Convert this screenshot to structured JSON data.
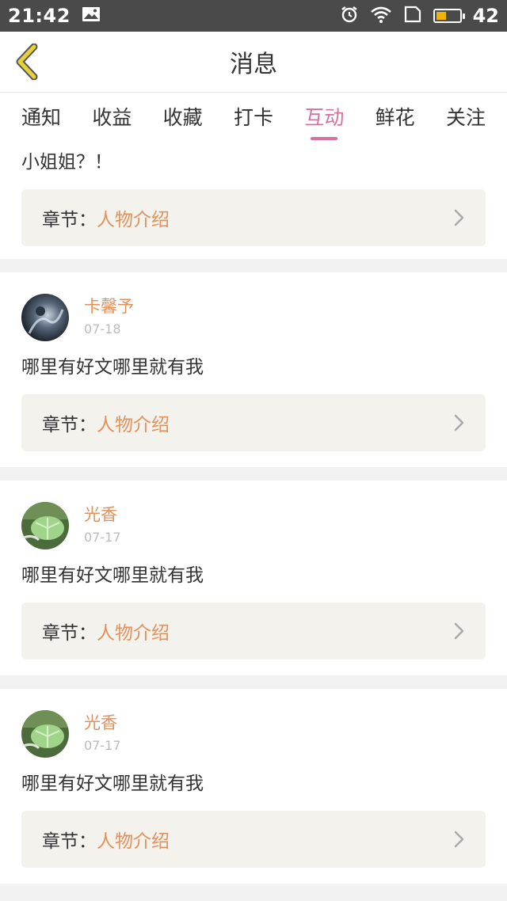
{
  "status_bar": {
    "time": "21:42",
    "battery": "42",
    "battery_level": 0.42,
    "icons": [
      "image-icon",
      "alarm-icon",
      "wifi-icon",
      "sim-icon",
      "battery-icon"
    ]
  },
  "header": {
    "title": "消息",
    "back_icon": "chevron-left-icon",
    "back_color": "#e5d23a"
  },
  "tabs": [
    {
      "label": "通知"
    },
    {
      "label": "收益"
    },
    {
      "label": "收藏"
    },
    {
      "label": "打卡"
    },
    {
      "label": "互动",
      "active": true
    },
    {
      "label": "鲜花"
    },
    {
      "label": "关注"
    }
  ],
  "colors": {
    "accent": "#d86fa0",
    "username": "#e2915b",
    "chapter_bg": "#f3f2ec"
  },
  "feed": {
    "partial_item": {
      "message": "小姐姐？！",
      "chapter_prefix": "章节：",
      "chapter_title": "人物介绍"
    },
    "items": [
      {
        "username": "卡馨予",
        "date": "07-18",
        "message": "哪里有好文哪里就有我",
        "chapter_prefix": "章节：",
        "chapter_title": "人物介绍"
      },
      {
        "username": "光香",
        "date": "07-17",
        "message": "哪里有好文哪里就有我",
        "chapter_prefix": "章节：",
        "chapter_title": "人物介绍"
      },
      {
        "username": "光香",
        "date": "07-17",
        "message": "哪里有好文哪里就有我",
        "chapter_prefix": "章节：",
        "chapter_title": "人物介绍"
      }
    ]
  }
}
